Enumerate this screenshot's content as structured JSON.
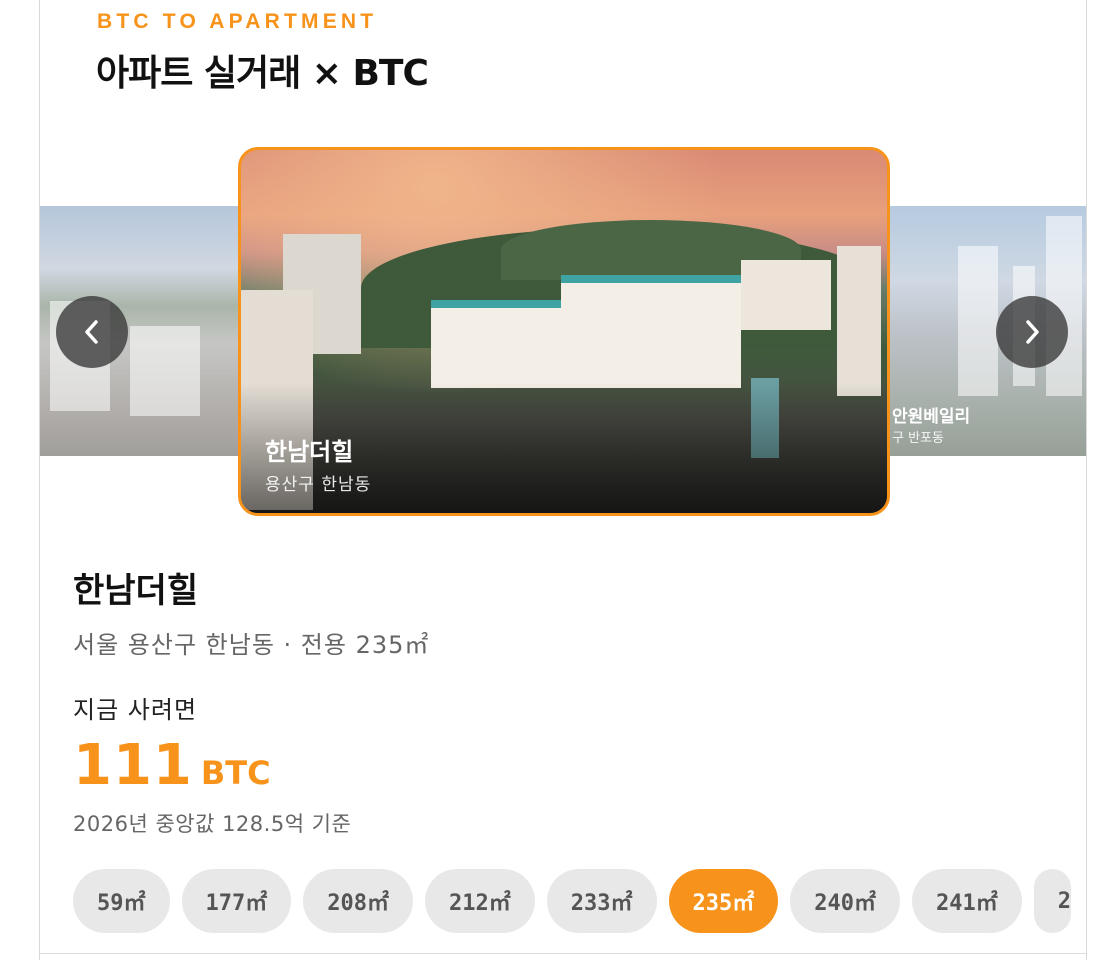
{
  "header": {
    "eyebrow": "BTC TO APARTMENT",
    "title": "아파트 실거래 × BTC"
  },
  "carousel": {
    "current": {
      "name": "한남더힐",
      "area": "용산구  한남동"
    },
    "next": {
      "name": "안원베일리",
      "area": "구  반포동"
    },
    "prev_icon": "chevron-left-icon",
    "next_icon": "chevron-right-icon"
  },
  "detail": {
    "name": "한남더힐",
    "meta": "서울  용산구  한남동  ·  전용  235㎡",
    "buy_label": "지금  사려면",
    "price_value": "111",
    "price_unit": "BTC",
    "basis": "2026년  중앙값  128.5억  기준"
  },
  "sizes": {
    "options": [
      "59㎡",
      "177㎡",
      "208㎡",
      "212㎡",
      "233㎡",
      "235㎡",
      "240㎡",
      "241㎡",
      "2"
    ],
    "selected": "235㎡"
  },
  "colors": {
    "accent": "#f7931a",
    "chip_bg": "#e8e8e8",
    "chip_text": "#555555"
  }
}
